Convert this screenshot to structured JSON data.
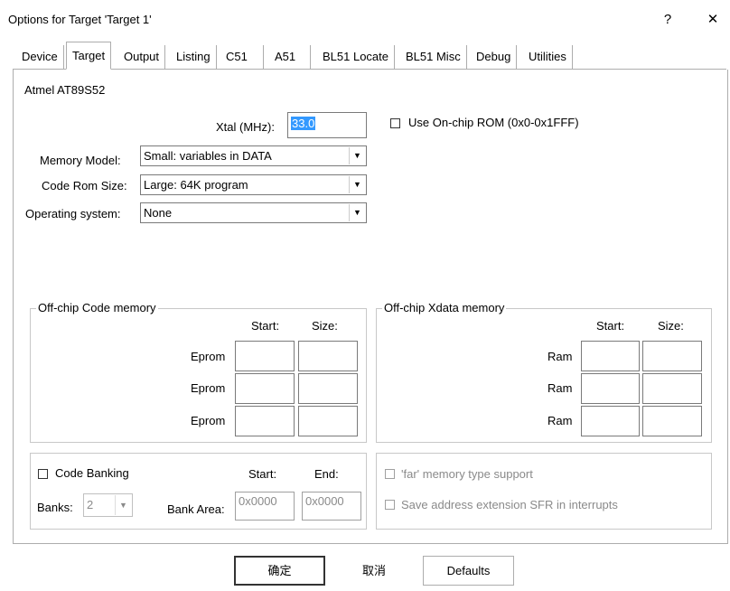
{
  "window": {
    "title": "Options for Target 'Target 1'",
    "help": "?",
    "close": "✕"
  },
  "tabs": [
    "Device",
    "Target",
    "Output",
    "Listing",
    "C51",
    "A51",
    "BL51 Locate",
    "BL51 Misc",
    "Debug",
    "Utilities"
  ],
  "active_tab": "Target",
  "device_name": "Atmel AT89S52",
  "xtal": {
    "label": "Xtal (MHz):",
    "value": "33.0"
  },
  "use_onchip_rom": {
    "label": "Use On-chip ROM (0x0-0x1FFF)",
    "checked": false
  },
  "memory_model": {
    "label": "Memory Model:",
    "value": "Small: variables in DATA"
  },
  "code_rom_size": {
    "label": "Code Rom Size:",
    "value": "Large: 64K program"
  },
  "operating_system": {
    "label": "Operating system:",
    "value": "None"
  },
  "offchip_code": {
    "title": "Off-chip Code memory",
    "start_header": "Start:",
    "size_header": "Size:",
    "rows": [
      "Eprom",
      "Eprom",
      "Eprom"
    ]
  },
  "offchip_xdata": {
    "title": "Off-chip Xdata memory",
    "start_header": "Start:",
    "size_header": "Size:",
    "rows": [
      "Ram",
      "Ram",
      "Ram"
    ]
  },
  "code_banking": {
    "label": "Code Banking",
    "start_header": "Start:",
    "end_header": "End:",
    "banks_label": "Banks:",
    "banks_value": "2",
    "bank_area_label": "Bank Area:",
    "bank_start": "0x0000",
    "bank_end": "0x0000"
  },
  "far_memory": {
    "label": "'far' memory type support"
  },
  "save_sfr": {
    "label": "Save address extension SFR in interrupts"
  },
  "buttons": {
    "ok": "确定",
    "cancel": "取消",
    "defaults": "Defaults"
  }
}
